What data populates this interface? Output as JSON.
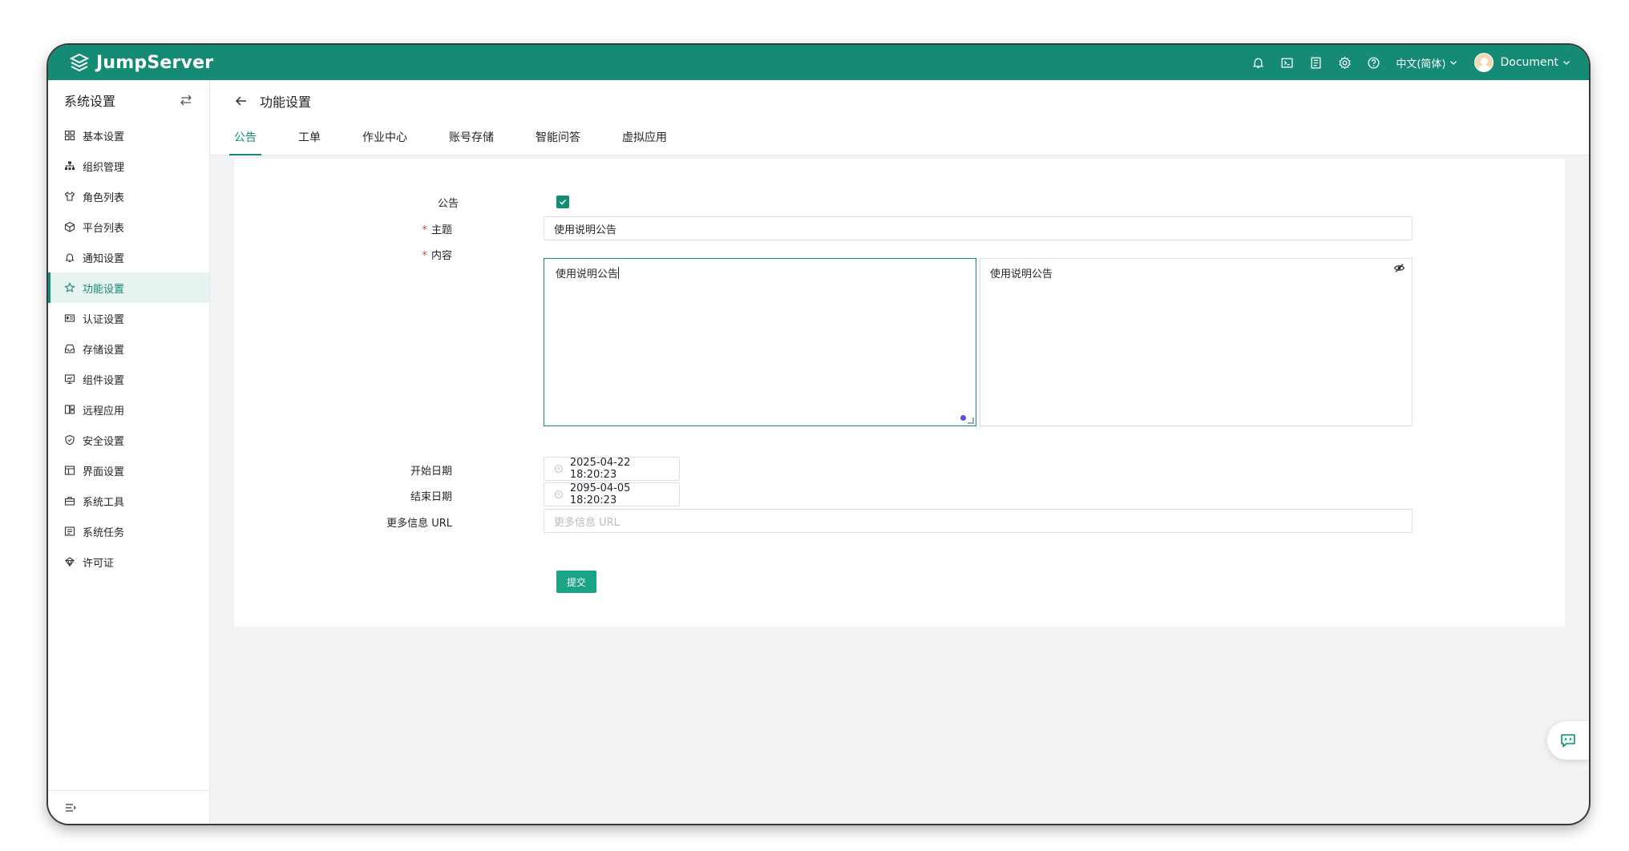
{
  "app": {
    "name": "JumpServer"
  },
  "header": {
    "language": "中文(简体)",
    "user": "Document"
  },
  "sidebar": {
    "title": "系统设置",
    "items": [
      {
        "label": "基本设置",
        "icon": "grid-icon"
      },
      {
        "label": "组织管理",
        "icon": "org-tree-icon"
      },
      {
        "label": "角色列表",
        "icon": "shirt-icon"
      },
      {
        "label": "平台列表",
        "icon": "cube-icon"
      },
      {
        "label": "通知设置",
        "icon": "bell-icon"
      },
      {
        "label": "功能设置",
        "icon": "star-icon",
        "active": true
      },
      {
        "label": "认证设置",
        "icon": "id-card-icon"
      },
      {
        "label": "存储设置",
        "icon": "inbox-icon"
      },
      {
        "label": "组件设置",
        "icon": "monitor-icon"
      },
      {
        "label": "远程应用",
        "icon": "apps-icon"
      },
      {
        "label": "安全设置",
        "icon": "shield-icon"
      },
      {
        "label": "界面设置",
        "icon": "layout-icon"
      },
      {
        "label": "系统工具",
        "icon": "toolbox-icon"
      },
      {
        "label": "系统任务",
        "icon": "task-icon"
      },
      {
        "label": "许可证",
        "icon": "license-icon"
      }
    ]
  },
  "page": {
    "title": "功能设置",
    "tabs": [
      "公告",
      "工单",
      "作业中心",
      "账号存储",
      "智能问答",
      "虚拟应用"
    ]
  },
  "form": {
    "announcement_label": "公告",
    "announcement_enabled": true,
    "subject_label": "主题",
    "subject_value": "使用说明公告",
    "content_label": "内容",
    "content_value": "使用说明公告",
    "preview_value": "使用说明公告",
    "start_label": "开始日期",
    "start_value": "2025-04-22 18:20:23",
    "end_label": "结束日期",
    "end_value": "2095-04-05 18:20:23",
    "url_label": "更多信息 URL",
    "url_placeholder": "更多信息 URL",
    "submit_label": "提交"
  },
  "colors": {
    "brand": "#158a74",
    "required": "#e0393e"
  }
}
